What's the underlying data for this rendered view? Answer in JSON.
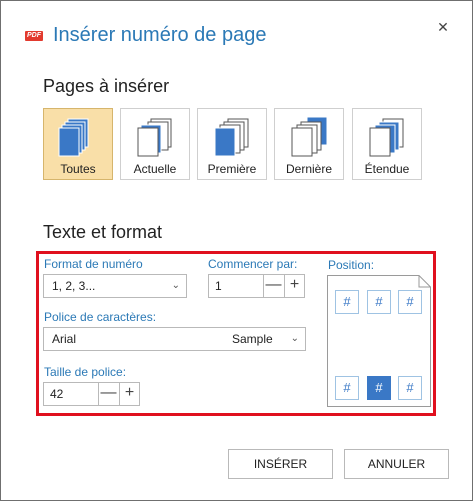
{
  "dialog": {
    "logo_text": "PDF",
    "title": "Insérer numéro de page",
    "close_glyph": "✕"
  },
  "pages_section": {
    "title": "Pages à insérer",
    "options": [
      {
        "label": "Toutes",
        "icon": "all-pages-icon",
        "selected": true
      },
      {
        "label": "Actuelle",
        "icon": "current-page-icon",
        "selected": false
      },
      {
        "label": "Première",
        "icon": "first-page-icon",
        "selected": false
      },
      {
        "label": "Dernière",
        "icon": "last-page-icon",
        "selected": false
      },
      {
        "label": "Étendue",
        "icon": "range-pages-icon",
        "selected": false
      }
    ]
  },
  "format_section": {
    "title": "Texte et format",
    "number_format_label": "Format de numéro",
    "number_format_value": "1, 2, 3...",
    "start_label": "Commencer par:",
    "start_value": "1",
    "font_label": "Police de caractères:",
    "font_value": "Arial",
    "font_sample": "Sample",
    "size_label": "Taille de police:",
    "size_value": "42",
    "position_label": "Position:",
    "position_glyph": "#",
    "selected_position": "bottom-center",
    "minus_glyph": "—",
    "plus_glyph": "+",
    "chevron_glyph": "⌄",
    "highlight_color": "#e0101e",
    "accent_color": "#3a78c6"
  },
  "footer": {
    "insert_label": "INSÉRER",
    "cancel_label": "ANNULER"
  }
}
